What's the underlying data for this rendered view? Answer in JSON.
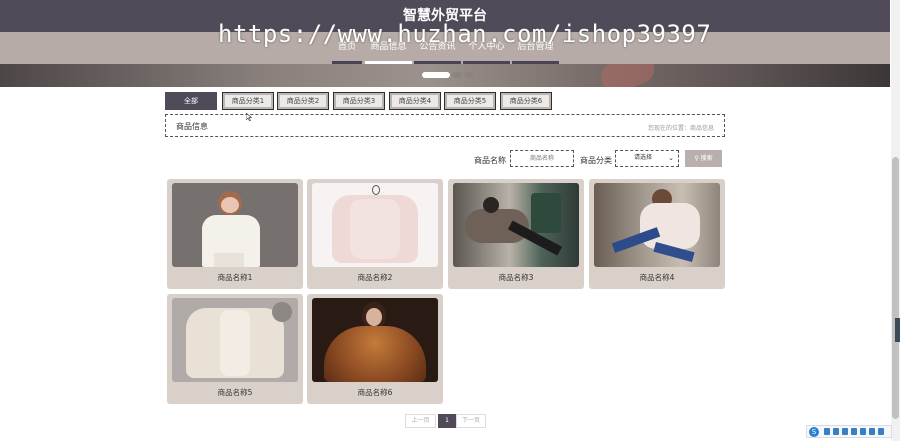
{
  "header": {
    "title": "智慧外贸平台",
    "watermark": "https://www.huzhan.com/ishop39397",
    "nav": [
      {
        "label": "首页",
        "active": false
      },
      {
        "label": "商品信息",
        "active": true
      },
      {
        "label": "公告资讯",
        "active": false
      },
      {
        "label": "个人中心",
        "active": false
      },
      {
        "label": "后台管理",
        "active": false
      }
    ]
  },
  "categories": [
    {
      "label": "全部",
      "active": true
    },
    {
      "label": "商品分类1",
      "active": false
    },
    {
      "label": "商品分类2",
      "active": false
    },
    {
      "label": "商品分类3",
      "active": false
    },
    {
      "label": "商品分类4",
      "active": false
    },
    {
      "label": "商品分类5",
      "active": false
    },
    {
      "label": "商品分类6",
      "active": false
    }
  ],
  "breadcrumb": {
    "title": "商品信息",
    "path": "您现在的位置：商品信息"
  },
  "search": {
    "name_label": "商品名称",
    "name_placeholder": "商品名称",
    "category_label": "商品分类",
    "category_selected": "请选择",
    "button_label": "搜索"
  },
  "products": [
    {
      "name": "商品名称1"
    },
    {
      "name": "商品名称2"
    },
    {
      "name": "商品名称3"
    },
    {
      "name": "商品名称4"
    },
    {
      "name": "商品名称5"
    },
    {
      "name": "商品名称6"
    }
  ],
  "pagination": {
    "prev": "上一页",
    "current": "1",
    "next": "下一页"
  },
  "tray": {
    "logo": "S"
  },
  "colors": {
    "header_bg": "#514a58",
    "nav_strip": "#b6aba6",
    "card_bg": "#d8d0c9",
    "accent": "#514a58"
  }
}
